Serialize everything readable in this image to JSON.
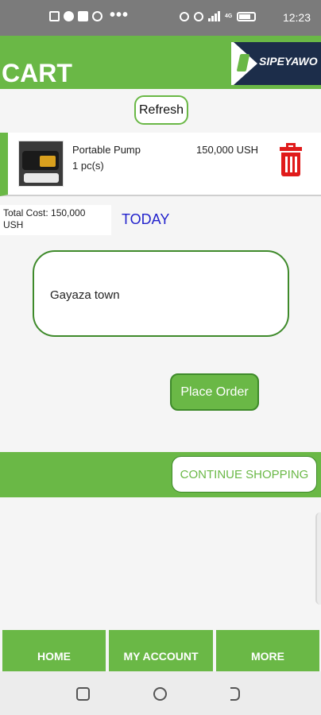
{
  "status_bar": {
    "time": "12:23",
    "icons": [
      "image-icon",
      "messenger-icon",
      "facebook-icon",
      "whatsapp-icon",
      "alarm-icon",
      "hotspot-icon",
      "volte-icon",
      "wifi-icon",
      "signal-icon",
      "battery-icon"
    ],
    "signal_tag": "4G"
  },
  "header": {
    "title": "CART",
    "logo_text": "SIPEYAWO"
  },
  "refresh_label": "Refresh",
  "cart_items": [
    {
      "name": "Portable Pump",
      "quantity": "1 pc(s)",
      "price": "150,000 USH",
      "delete_icon": "trash-icon"
    }
  ],
  "summary": {
    "total_cost": "Total Cost: 150,000 USH",
    "delivery_day": "TODAY"
  },
  "address_value": "Gayaza town",
  "place_order_label": "Place Order",
  "continue_label": "CONTINUE SHOPPING",
  "bottom_nav": {
    "items": [
      "HOME",
      "MY ACCOUNT",
      "MORE"
    ]
  },
  "colors": {
    "brand_green": "#6ab846",
    "dark_green": "#3e8a2a",
    "delete_red": "#e01b1b",
    "day_blue": "#2222cc",
    "logo_navy": "#1c2d4a"
  }
}
